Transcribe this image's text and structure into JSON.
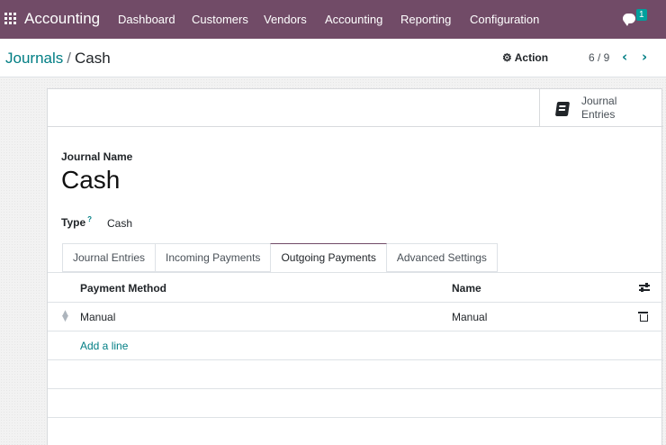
{
  "navbar": {
    "brand": "Accounting",
    "items": [
      "Dashboard",
      "Customers",
      "Vendors",
      "Accounting",
      "Reporting",
      "Configuration"
    ],
    "chat_badge": "1"
  },
  "control": {
    "breadcrumb_parent": "Journals",
    "breadcrumb_separator": "/",
    "breadcrumb_current": "Cash",
    "action_label": "Action",
    "pager": "6 / 9"
  },
  "smart_button": {
    "line1": "Journal",
    "line2": "Entries"
  },
  "form": {
    "journal_name_label": "Journal Name",
    "journal_name": "Cash",
    "type_label": "Type",
    "type_help": "?",
    "type_value": "Cash"
  },
  "tabs": [
    {
      "label": "Journal Entries",
      "active": false
    },
    {
      "label": "Incoming Payments",
      "active": false
    },
    {
      "label": "Outgoing Payments",
      "active": true
    },
    {
      "label": "Advanced Settings",
      "active": false
    }
  ],
  "table": {
    "columns": [
      "Payment Method",
      "Name"
    ],
    "rows": [
      {
        "payment_method": "Manual",
        "name": "Manual"
      }
    ],
    "add_line": "Add a line"
  },
  "colors": {
    "brand": "#714b67",
    "link": "#017e84",
    "badge": "#00a09d"
  }
}
